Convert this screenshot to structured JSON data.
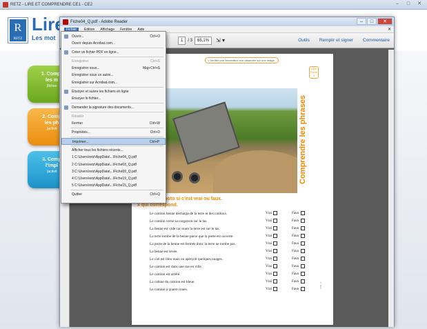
{
  "outer_window": {
    "title": "RETZ - LIRE ET COMPRENDRE CE1 - CE2",
    "controls": [
      "–",
      "□",
      "✕"
    ]
  },
  "app": {
    "logo_letter": "R",
    "logo_sub": "RETZ",
    "title": "Lire",
    "subtitle": "Les mot"
  },
  "side_buttons": [
    {
      "line1": "1. Compr",
      "line2": "les m",
      "sub": "(fiches"
    },
    {
      "line1": "2. Comp",
      "line2": "les ph",
      "sub": "(activit"
    },
    {
      "line1": "3. Comp",
      "line2": "l'impl",
      "sub": "(activit"
    }
  ],
  "reader": {
    "title": "Fiche04_Q.pdf - Adobe Reader",
    "menubar": [
      "Fichier",
      "Edition",
      "Affichage",
      "Fenêtre",
      "Aide"
    ],
    "page_current": "1",
    "page_total": "/ 3",
    "zoom": "65,1%",
    "tool_links": [
      "Outils",
      "Remplir et signer",
      "Commentaire"
    ]
  },
  "file_menu": [
    {
      "label": "Ouvrir...",
      "shortcut": "Ctrl+O",
      "icon": true
    },
    {
      "label": "Ouvrir depuis Acrobat.com...",
      "shortcut": ""
    },
    {
      "sep": true
    },
    {
      "label": "Créer un fichier PDF en ligne...",
      "shortcut": "",
      "icon": true
    },
    {
      "sep": true
    },
    {
      "label": "Enregistrer",
      "shortcut": "Ctrl+S",
      "disabled": true
    },
    {
      "label": "Enregistrer sous...",
      "shortcut": "Maj+Ctrl+S"
    },
    {
      "label": "Enregistrer sous un autre...",
      "shortcut": ""
    },
    {
      "label": "Enregistrer sur Acrobat.com...",
      "shortcut": ""
    },
    {
      "sep": true
    },
    {
      "label": "Envoyer et suivre les fichiers en ligne",
      "shortcut": "",
      "icon": true
    },
    {
      "label": "Envoyer le fichier...",
      "shortcut": ""
    },
    {
      "sep": true
    },
    {
      "label": "Demander la signature des documents...",
      "shortcut": "",
      "icon": true
    },
    {
      "sep": true
    },
    {
      "label": "Rétablir",
      "shortcut": "",
      "disabled": true
    },
    {
      "label": "Fermer",
      "shortcut": "Ctrl+W"
    },
    {
      "sep": true
    },
    {
      "label": "Propriétés...",
      "shortcut": "Ctrl+D"
    },
    {
      "sep": true
    },
    {
      "label": "Imprimer...",
      "shortcut": "Ctrl+P",
      "highlight": true
    },
    {
      "sep": true
    },
    {
      "label": "Afficher tous les fichiers récents...",
      "shortcut": ""
    },
    {
      "label": "1 C:\\Users\\retz\\AppData\\...\\Fiche04_Q.pdf",
      "shortcut": ""
    },
    {
      "label": "2 C:\\Users\\retz\\AppData\\...\\Fiche03_Q.pdf",
      "shortcut": ""
    },
    {
      "label": "3 C:\\Users\\retz\\AppData\\...\\Fiche09_Q.pdf",
      "shortcut": ""
    },
    {
      "label": "4 C:\\Users\\retz\\AppData\\...\\Fiche19_Q.pdf",
      "shortcut": ""
    },
    {
      "label": "5 C:\\Users\\retz\\AppData\\...\\Fiche15_Q.pdf",
      "shortcut": ""
    },
    {
      "sep": true
    },
    {
      "label": "Quitter",
      "shortcut": "Ctrl+Q"
    }
  ],
  "page": {
    "hint": "• Vérifier une information non observée sur une image.",
    "level": "CE2",
    "fiche": "Fiche 4",
    "vertical_title": "Comprendre les phrases",
    "instruction_1": "ode sur la photo si c'est vrai ou faux.",
    "instruction_2": "x qui correspond.",
    "rows": [
      "Le camion benne décharge de la terre et des cailloux.",
      "Le camion verse sa cargaison sur le tas.",
      "La benne est vide car toute la terre est sur le tas.",
      "La terre tombe de la benne parce que la porte est ouverte.",
      "La porte de la benne est fermée donc la terre ne tombe pas.",
      "La benne est levée.",
      "Le ciel est bleu mais on aperçoit quelques nuages.",
      "Le camion est dans une rue en ville.",
      "Le camion est arrêté.",
      "La cabine du camion est bleue.",
      "Le camion a quatre roues."
    ],
    "vrai": "Vrai",
    "faux": "Faux",
    "footnote": "© Retz"
  }
}
